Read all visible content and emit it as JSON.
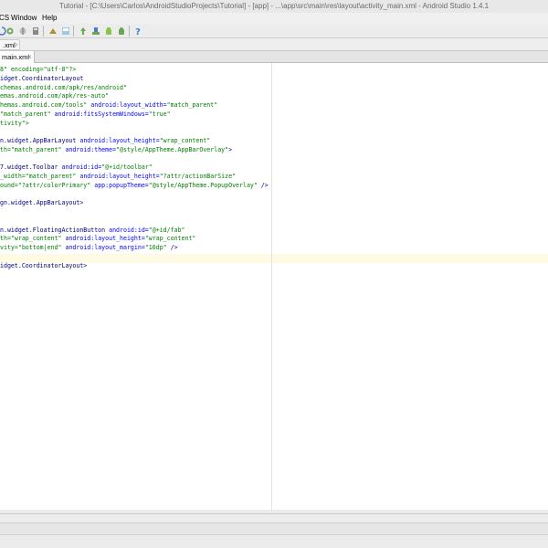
{
  "window": {
    "title": "Tutorial - [C:\\Users\\Carlos\\AndroidStudioProjects\\Tutorial] - [app] - ...\\app\\src\\main\\res\\layout\\activity_main.xml - Android Studio 1.4.1"
  },
  "menu": {
    "vcs_fragment": "CS",
    "window": "Window",
    "help": "Help"
  },
  "toolbar": {
    "icons": [
      "reload-icon",
      "stop-icon",
      "build-icon",
      "project-structure-icon",
      "sdk-manager-icon",
      "avd-manager-icon",
      "sync-icon",
      "android-monitor-icon",
      "device-icon",
      "help-icon"
    ]
  },
  "breadcrumb": {
    "label": ".xml"
  },
  "tabs": [
    {
      "label": "main.xml"
    }
  ],
  "editor": {
    "lines": [
      [
        [
          "8\" encoding=\"utf-8\"?>",
          "v"
        ]
      ],
      [
        [
          "idget.CoordinatorLayout",
          "n"
        ]
      ],
      [
        [
          "chemas.android.com/apk/res/android\"",
          "v"
        ]
      ],
      [
        [
          "emas.android.com/apk/res-auto\"",
          "v"
        ]
      ],
      [
        [
          "hemas.android.com/tools\" ",
          "v"
        ],
        [
          "android:layout_width=",
          "a"
        ],
        [
          "\"match_parent\"",
          "v"
        ]
      ],
      [
        [
          "\"match_parent\" ",
          "v"
        ],
        [
          "android:fitsSystemWindows=",
          "a"
        ],
        [
          "\"true\"",
          "v"
        ]
      ],
      [
        [
          "tivity\">",
          "v"
        ]
      ],
      [
        [
          "",
          "n"
        ]
      ],
      [
        [
          "n.widget.AppBarLayout ",
          "n"
        ],
        [
          "android:layout_height=",
          "a"
        ],
        [
          "\"wrap_content\"",
          "v"
        ]
      ],
      [
        [
          "th=\"match_parent\" ",
          "v"
        ],
        [
          "android:theme=",
          "a"
        ],
        [
          "\"@style/AppTheme.AppBarOverlay\"",
          "v"
        ],
        [
          ">",
          "n"
        ]
      ],
      [
        [
          "",
          "n"
        ]
      ],
      [
        [
          "7.widget.Toolbar ",
          "n"
        ],
        [
          "android:id=",
          "a"
        ],
        [
          "\"@+id/toolbar\"",
          "v"
        ]
      ],
      [
        [
          "_width=\"match_parent\" ",
          "v"
        ],
        [
          "android:layout_height=",
          "a"
        ],
        [
          "\"?attr/actionBarSize\"",
          "v"
        ]
      ],
      [
        [
          "ound=\"?attr/colorPrimary\" ",
          "v"
        ],
        [
          "app:popupTheme=",
          "a"
        ],
        [
          "\"@style/AppTheme.PopupOverlay\"",
          "v"
        ],
        [
          " />",
          "n"
        ]
      ],
      [
        [
          "",
          "n"
        ]
      ],
      [
        [
          "gn.widget.AppBarLayout>",
          "n"
        ]
      ],
      [
        [
          "",
          "n"
        ]
      ],
      [
        [
          "",
          "n"
        ]
      ],
      [
        [
          "n.widget.FloatingActionButton ",
          "n"
        ],
        [
          "android:id=",
          "a"
        ],
        [
          "\"@+id/fab\"",
          "v"
        ]
      ],
      [
        [
          "th=\"wrap_content\" ",
          "v"
        ],
        [
          "android:layout_height=",
          "a"
        ],
        [
          "\"wrap_content\"",
          "v"
        ]
      ],
      [
        [
          "vity=\"bottom|end\" ",
          "v"
        ],
        [
          "android:layout_margin=",
          "a"
        ],
        [
          "\"16dp\"",
          "v"
        ],
        [
          " />",
          "n"
        ]
      ],
      [
        [
          "",
          "n"
        ]
      ],
      [
        [
          "idget.CoordinatorLayout>",
          "n"
        ]
      ]
    ]
  }
}
